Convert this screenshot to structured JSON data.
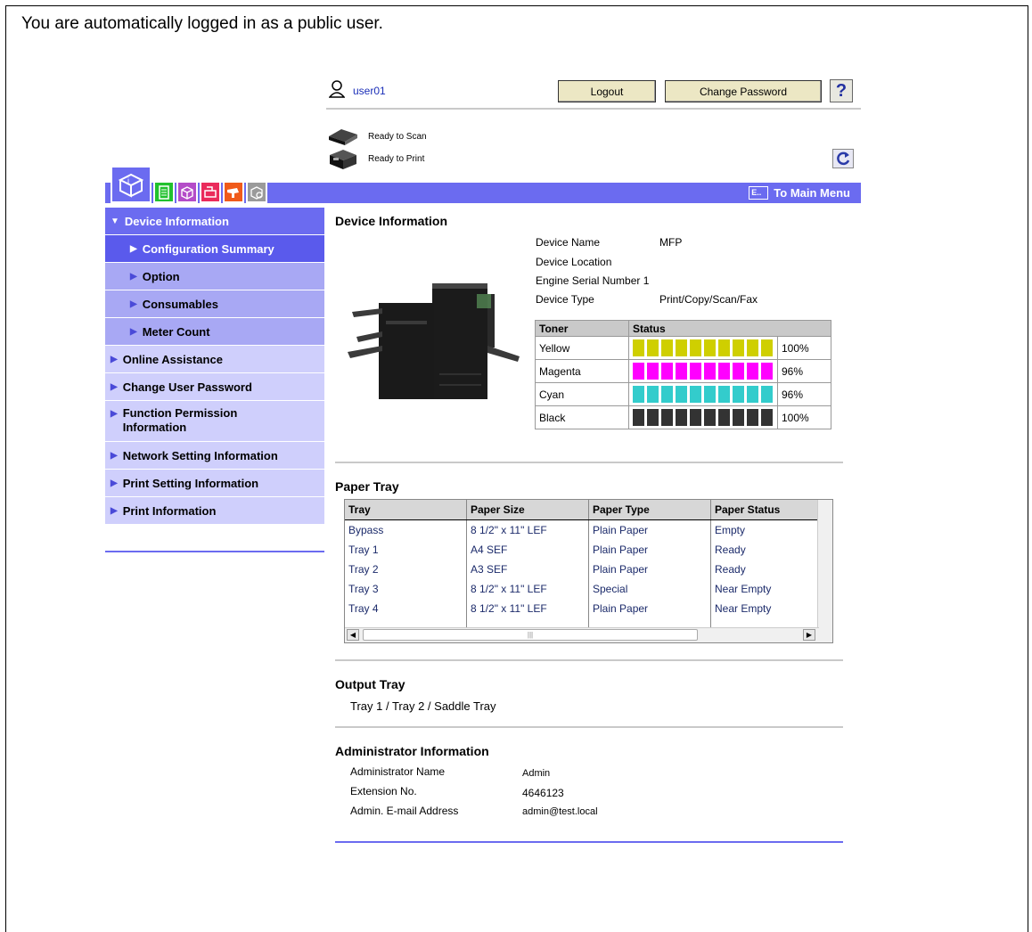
{
  "notice": "You are automatically logged in as a public user.",
  "header": {
    "user": "user01",
    "logout_label": "Logout",
    "change_password_label": "Change Password",
    "help_label": "?"
  },
  "status": {
    "scan": "Ready to Scan",
    "print": "Ready to Print"
  },
  "tabs": [
    "device-info-tab",
    "job-tab",
    "box-tab",
    "print-tab",
    "store-address-tab",
    "network-tab"
  ],
  "main_menu_label": "To Main Menu",
  "sidebar": {
    "items": [
      {
        "label": "Device Information"
      },
      {
        "label": "Configuration Summary"
      },
      {
        "label": "Option"
      },
      {
        "label": "Consumables"
      },
      {
        "label": "Meter Count"
      },
      {
        "label": "Online Assistance"
      },
      {
        "label": "Change User Password"
      },
      {
        "label": "Function Permission Information"
      },
      {
        "label": "Network Setting Information"
      },
      {
        "label": "Print Setting Information"
      },
      {
        "label": "Print Information"
      }
    ]
  },
  "device_info": {
    "title": "Device Information",
    "rows": [
      {
        "label": "Device Name",
        "value": "MFP"
      },
      {
        "label": "Device Location",
        "value": ""
      },
      {
        "label": "Engine Serial Number 1",
        "value": ""
      },
      {
        "label": "Device Type",
        "value": "Print/Copy/Scan/Fax"
      }
    ]
  },
  "toner": {
    "headers": [
      "Toner",
      "Status"
    ],
    "rows": [
      {
        "name": "Yellow",
        "level": 100,
        "percent": "100%",
        "color": "#cfcf00"
      },
      {
        "name": "Magenta",
        "level": 96,
        "percent": "96%",
        "color": "#ff00ff"
      },
      {
        "name": "Cyan",
        "level": 96,
        "percent": "96%",
        "color": "#33cccc"
      },
      {
        "name": "Black",
        "level": 100,
        "percent": "100%",
        "color": "#333333"
      }
    ]
  },
  "paper_tray": {
    "title": "Paper Tray",
    "headers": [
      "Tray",
      "Paper Size",
      "Paper Type",
      "Paper Status"
    ],
    "rows": [
      [
        "Bypass",
        "8 1/2\" x 11\" LEF",
        "Plain Paper",
        "Empty"
      ],
      [
        "Tray 1",
        "A4 SEF",
        "Plain Paper",
        "Ready"
      ],
      [
        "Tray 2",
        "A3 SEF",
        "Plain Paper",
        "Ready"
      ],
      [
        "Tray 3",
        "8 1/2\" x 11\" LEF",
        "Special",
        "Near Empty"
      ],
      [
        "Tray 4",
        "8 1/2\" x 11\" LEF",
        "Plain Paper",
        "Near Empty"
      ]
    ]
  },
  "output_tray": {
    "title": "Output Tray",
    "value": "Tray 1 / Tray 2 / Saddle Tray"
  },
  "admin": {
    "title": "Administrator Information",
    "rows": [
      {
        "label": "Administrator Name",
        "value": "Admin"
      },
      {
        "label": "Extension No.",
        "value": "4646123"
      },
      {
        "label": "Admin. E-mail Address",
        "value": "admin@test.local"
      }
    ]
  },
  "colors": {
    "accent": "#6b6bf0",
    "sidebar_light": "#cfcffc",
    "sidebar_sub": "#a8a8f4",
    "sidebar_active": "#5a5aec",
    "button": "#ece7c4"
  }
}
